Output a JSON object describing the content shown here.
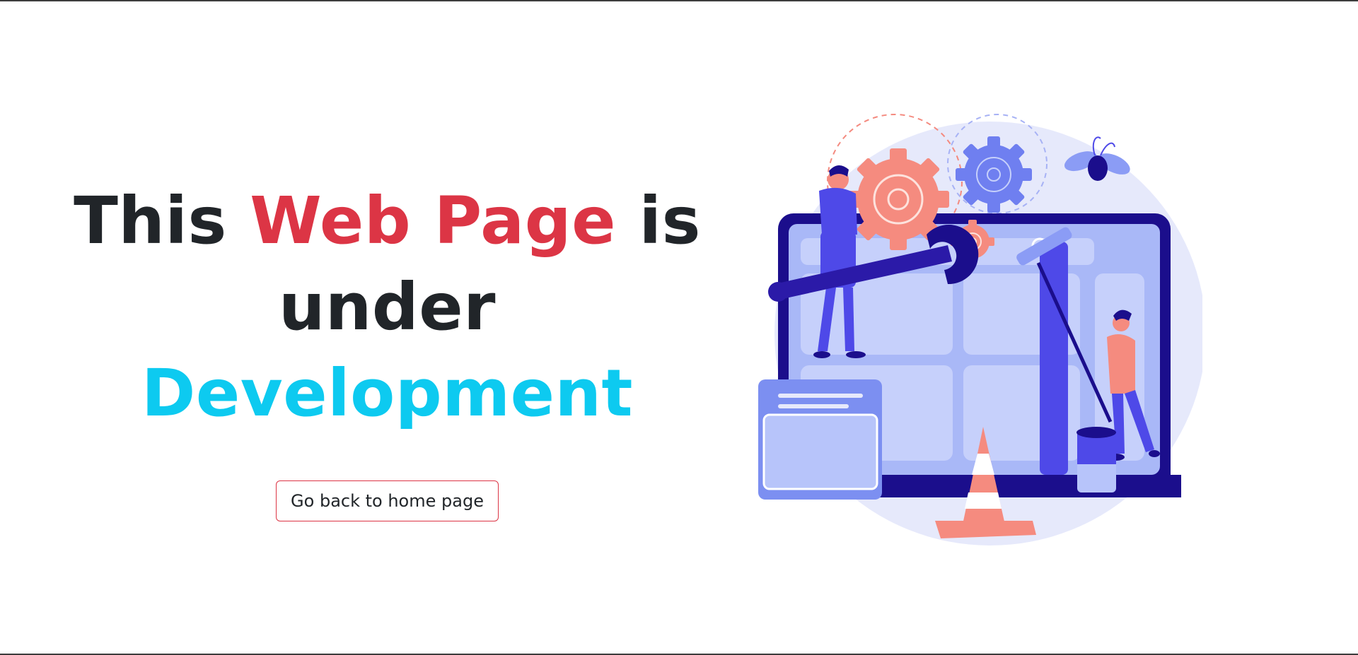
{
  "headline": {
    "part1": "This ",
    "part2": "Web Page",
    "part3": " is under ",
    "part4": "Development"
  },
  "home_button": {
    "label": "Go back to home page"
  },
  "colors": {
    "dark": "#212529",
    "red": "#dc3545",
    "cyan": "#0dcaf0"
  },
  "illustration": {
    "icon": "under-construction-illustration"
  }
}
